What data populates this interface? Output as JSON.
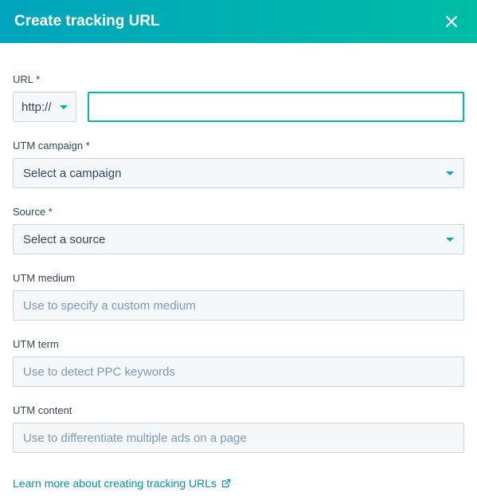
{
  "header": {
    "title": "Create tracking URL"
  },
  "fields": {
    "url": {
      "label": "URL *",
      "protocol": "http://",
      "value": ""
    },
    "campaign": {
      "label": "UTM campaign *",
      "placeholder": "Select a campaign"
    },
    "source": {
      "label": "Source *",
      "placeholder": "Select a source"
    },
    "medium": {
      "label": "UTM medium",
      "placeholder": "Use to specify a custom medium"
    },
    "term": {
      "label": "UTM term",
      "placeholder": "Use to detect PPC keywords"
    },
    "content": {
      "label": "UTM content",
      "placeholder": "Use to differentiate multiple ads on a page"
    }
  },
  "footer": {
    "learn_more": "Learn more about creating tracking URLs"
  }
}
